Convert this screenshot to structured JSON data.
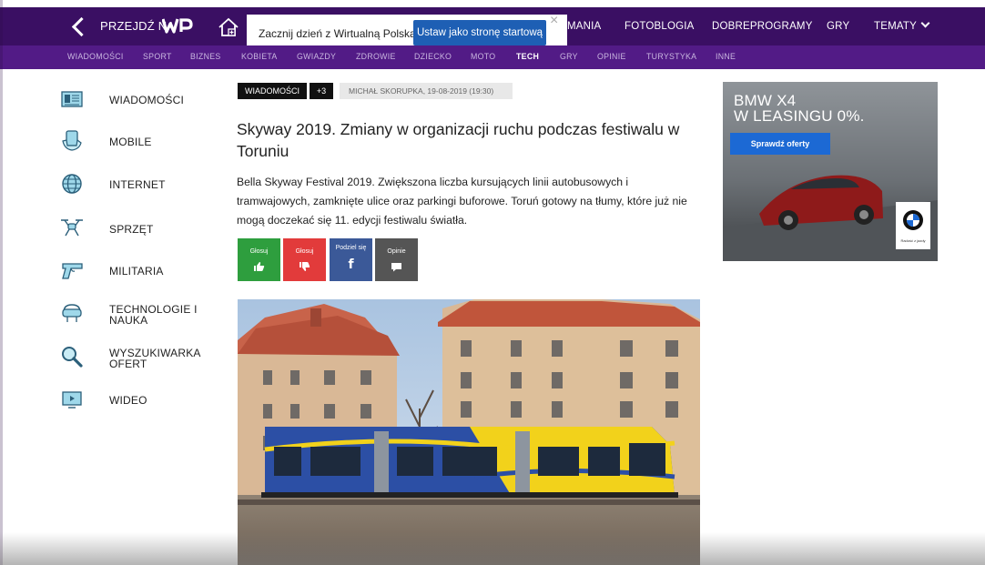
{
  "topbar": {
    "goto_label": "PRZEJDŹ NA",
    "logo_text": "WP",
    "promo_text": "Zacznij dzień z Wirtualną Polską.",
    "promo_button": "Ustaw jako stronę startową",
    "promo_close": "×",
    "nav_items": [
      "MANIA",
      "FOTOBLOGIA",
      "DOBREPROGRAMY",
      "GRY",
      "TEMATY"
    ]
  },
  "subnav": {
    "items": [
      "WIADOMOŚCI",
      "SPORT",
      "BIZNES",
      "KOBIETA",
      "GWIAZDY",
      "ZDROWIE",
      "DZIECKO",
      "MOTO",
      "TECH",
      "GRY",
      "OPINIE",
      "TURYSTYKA",
      "INNE"
    ],
    "active": "TECH"
  },
  "sidebar": {
    "items": [
      {
        "label": "WIADOMOŚCI",
        "icon": "newspaper-icon"
      },
      {
        "label": "MOBILE",
        "icon": "phone-in-hand-icon"
      },
      {
        "label": "INTERNET",
        "icon": "globe-icon"
      },
      {
        "label": "SPRZĘT",
        "icon": "drone-icon"
      },
      {
        "label": "MILITARIA",
        "icon": "pistol-icon"
      },
      {
        "label": "TECHNOLOGIE I",
        "label2": "NAUKA",
        "icon": "vr-headset-icon"
      },
      {
        "label": "WYSZUKIWARKA",
        "label2": "OFERT",
        "icon": "magnifier-icon"
      },
      {
        "label": "WIDEO",
        "icon": "monitor-play-icon"
      }
    ]
  },
  "article": {
    "category": "WIADOMOŚCI",
    "more_tags": "+3",
    "byline": "MICHAŁ SKORUPKA, 19-08-2019 (19:30)",
    "title": "Skyway 2019. Zmiany w organizacji ruchu podczas festiwalu w Toruniu",
    "lead": "Bella Skyway Festival 2019. Zwiększona liczba kursujących linii autobusowych i tramwajowych, zamknięte ulice oraz parkingi buforowe. Toruń gotowy na tłumy, które już nie mogą doczekać się 11. edycji festiwalu światła.",
    "share_buttons": [
      {
        "label": "Głosuj",
        "icon": "thumbs-up-icon",
        "color": "#2e9e3e"
      },
      {
        "label": "Głosuj",
        "icon": "thumbs-down-icon",
        "color": "#e23b3b"
      },
      {
        "label": "Podziel się",
        "icon": "facebook-icon",
        "color": "#3b5998"
      },
      {
        "label": "Opinie",
        "icon": "comment-icon",
        "color": "#555555"
      }
    ]
  },
  "ad": {
    "title_line1": "BMW X4",
    "title_line2": "W LEASINGU 0%.",
    "cta": "Sprawdź oferty",
    "badge_text": "Radość z jazdy"
  },
  "colors": {
    "topbar": "#3a0f63",
    "subnav": "#521b86",
    "promo_button": "#1e5fb4"
  }
}
